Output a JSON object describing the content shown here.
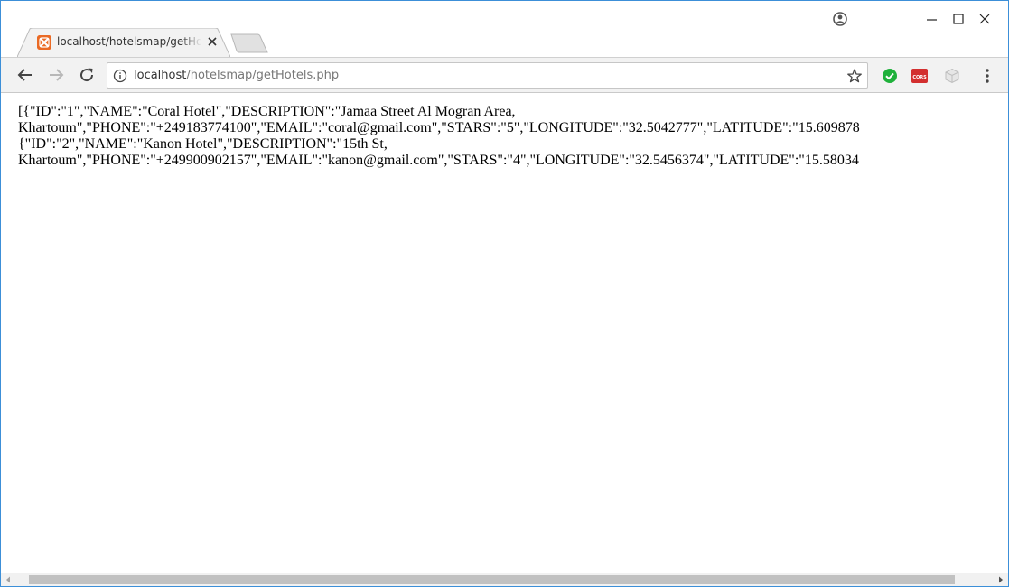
{
  "window": {
    "tab": {
      "title": "localhost/hotelsmap/getHotels.php",
      "favicon": "xampp-icon",
      "favicon_color": "#ea6a25"
    },
    "controls": [
      "profile-icon",
      "minimize-icon",
      "maximize-icon",
      "close-icon"
    ]
  },
  "toolbar": {
    "url_host": "localhost",
    "url_path": "/hotelsmap/getHotels.php",
    "extensions": [
      {
        "name": "check-icon",
        "color": "#1fb13b"
      },
      {
        "name": "cors-icon",
        "label": "CORS",
        "color": "#d32f2f"
      },
      {
        "name": "cube-icon",
        "color": "#bdbdbd"
      }
    ]
  },
  "content": {
    "lines": [
      "[{\"ID\":\"1\",\"NAME\":\"Coral Hotel\",\"DESCRIPTION\":\"Jamaa Street Al Mogran Area,",
      "Khartoum\",\"PHONE\":\"+249183774100\",\"EMAIL\":\"coral@gmail.com\",\"STARS\":\"5\",\"LONGITUDE\":\"32.5042777\",\"LATITUDE\":\"15.609878",
      "{\"ID\":\"2\",\"NAME\":\"Kanon Hotel\",\"DESCRIPTION\":\"15th St,",
      "Khartoum\",\"PHONE\":\"+249900902157\",\"EMAIL\":\"kanon@gmail.com\",\"STARS\":\"4\",\"LONGITUDE\":\"32.5456374\",\"LATITUDE\":\"15.58034"
    ]
  }
}
